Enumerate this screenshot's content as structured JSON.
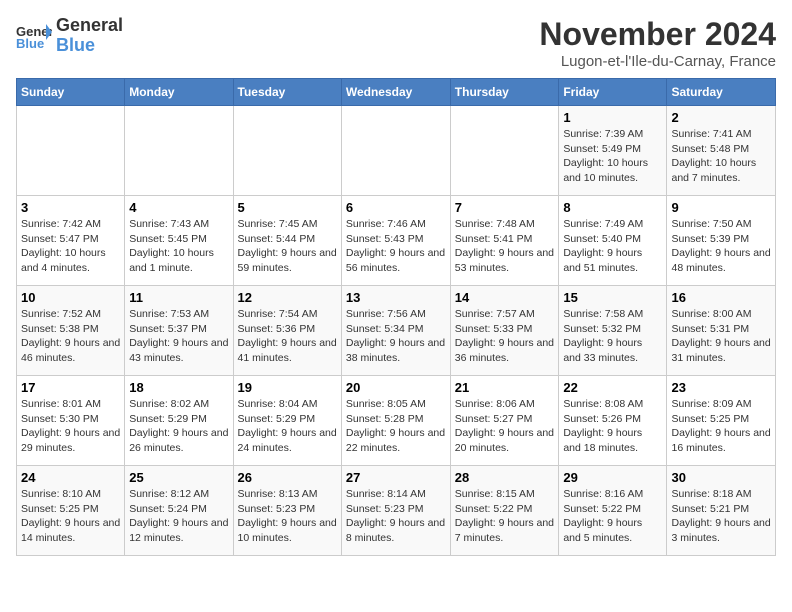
{
  "logo": {
    "general": "General",
    "blue": "Blue"
  },
  "title": "November 2024",
  "location": "Lugon-et-l'Ile-du-Carnay, France",
  "weekdays": [
    "Sunday",
    "Monday",
    "Tuesday",
    "Wednesday",
    "Thursday",
    "Friday",
    "Saturday"
  ],
  "weeks": [
    [
      {
        "day": "",
        "info": ""
      },
      {
        "day": "",
        "info": ""
      },
      {
        "day": "",
        "info": ""
      },
      {
        "day": "",
        "info": ""
      },
      {
        "day": "",
        "info": ""
      },
      {
        "day": "1",
        "info": "Sunrise: 7:39 AM\nSunset: 5:49 PM\nDaylight: 10 hours and 10 minutes."
      },
      {
        "day": "2",
        "info": "Sunrise: 7:41 AM\nSunset: 5:48 PM\nDaylight: 10 hours and 7 minutes."
      }
    ],
    [
      {
        "day": "3",
        "info": "Sunrise: 7:42 AM\nSunset: 5:47 PM\nDaylight: 10 hours and 4 minutes."
      },
      {
        "day": "4",
        "info": "Sunrise: 7:43 AM\nSunset: 5:45 PM\nDaylight: 10 hours and 1 minute."
      },
      {
        "day": "5",
        "info": "Sunrise: 7:45 AM\nSunset: 5:44 PM\nDaylight: 9 hours and 59 minutes."
      },
      {
        "day": "6",
        "info": "Sunrise: 7:46 AM\nSunset: 5:43 PM\nDaylight: 9 hours and 56 minutes."
      },
      {
        "day": "7",
        "info": "Sunrise: 7:48 AM\nSunset: 5:41 PM\nDaylight: 9 hours and 53 minutes."
      },
      {
        "day": "8",
        "info": "Sunrise: 7:49 AM\nSunset: 5:40 PM\nDaylight: 9 hours and 51 minutes."
      },
      {
        "day": "9",
        "info": "Sunrise: 7:50 AM\nSunset: 5:39 PM\nDaylight: 9 hours and 48 minutes."
      }
    ],
    [
      {
        "day": "10",
        "info": "Sunrise: 7:52 AM\nSunset: 5:38 PM\nDaylight: 9 hours and 46 minutes."
      },
      {
        "day": "11",
        "info": "Sunrise: 7:53 AM\nSunset: 5:37 PM\nDaylight: 9 hours and 43 minutes."
      },
      {
        "day": "12",
        "info": "Sunrise: 7:54 AM\nSunset: 5:36 PM\nDaylight: 9 hours and 41 minutes."
      },
      {
        "day": "13",
        "info": "Sunrise: 7:56 AM\nSunset: 5:34 PM\nDaylight: 9 hours and 38 minutes."
      },
      {
        "day": "14",
        "info": "Sunrise: 7:57 AM\nSunset: 5:33 PM\nDaylight: 9 hours and 36 minutes."
      },
      {
        "day": "15",
        "info": "Sunrise: 7:58 AM\nSunset: 5:32 PM\nDaylight: 9 hours and 33 minutes."
      },
      {
        "day": "16",
        "info": "Sunrise: 8:00 AM\nSunset: 5:31 PM\nDaylight: 9 hours and 31 minutes."
      }
    ],
    [
      {
        "day": "17",
        "info": "Sunrise: 8:01 AM\nSunset: 5:30 PM\nDaylight: 9 hours and 29 minutes."
      },
      {
        "day": "18",
        "info": "Sunrise: 8:02 AM\nSunset: 5:29 PM\nDaylight: 9 hours and 26 minutes."
      },
      {
        "day": "19",
        "info": "Sunrise: 8:04 AM\nSunset: 5:29 PM\nDaylight: 9 hours and 24 minutes."
      },
      {
        "day": "20",
        "info": "Sunrise: 8:05 AM\nSunset: 5:28 PM\nDaylight: 9 hours and 22 minutes."
      },
      {
        "day": "21",
        "info": "Sunrise: 8:06 AM\nSunset: 5:27 PM\nDaylight: 9 hours and 20 minutes."
      },
      {
        "day": "22",
        "info": "Sunrise: 8:08 AM\nSunset: 5:26 PM\nDaylight: 9 hours and 18 minutes."
      },
      {
        "day": "23",
        "info": "Sunrise: 8:09 AM\nSunset: 5:25 PM\nDaylight: 9 hours and 16 minutes."
      }
    ],
    [
      {
        "day": "24",
        "info": "Sunrise: 8:10 AM\nSunset: 5:25 PM\nDaylight: 9 hours and 14 minutes."
      },
      {
        "day": "25",
        "info": "Sunrise: 8:12 AM\nSunset: 5:24 PM\nDaylight: 9 hours and 12 minutes."
      },
      {
        "day": "26",
        "info": "Sunrise: 8:13 AM\nSunset: 5:23 PM\nDaylight: 9 hours and 10 minutes."
      },
      {
        "day": "27",
        "info": "Sunrise: 8:14 AM\nSunset: 5:23 PM\nDaylight: 9 hours and 8 minutes."
      },
      {
        "day": "28",
        "info": "Sunrise: 8:15 AM\nSunset: 5:22 PM\nDaylight: 9 hours and 7 minutes."
      },
      {
        "day": "29",
        "info": "Sunrise: 8:16 AM\nSunset: 5:22 PM\nDaylight: 9 hours and 5 minutes."
      },
      {
        "day": "30",
        "info": "Sunrise: 8:18 AM\nSunset: 5:21 PM\nDaylight: 9 hours and 3 minutes."
      }
    ]
  ]
}
